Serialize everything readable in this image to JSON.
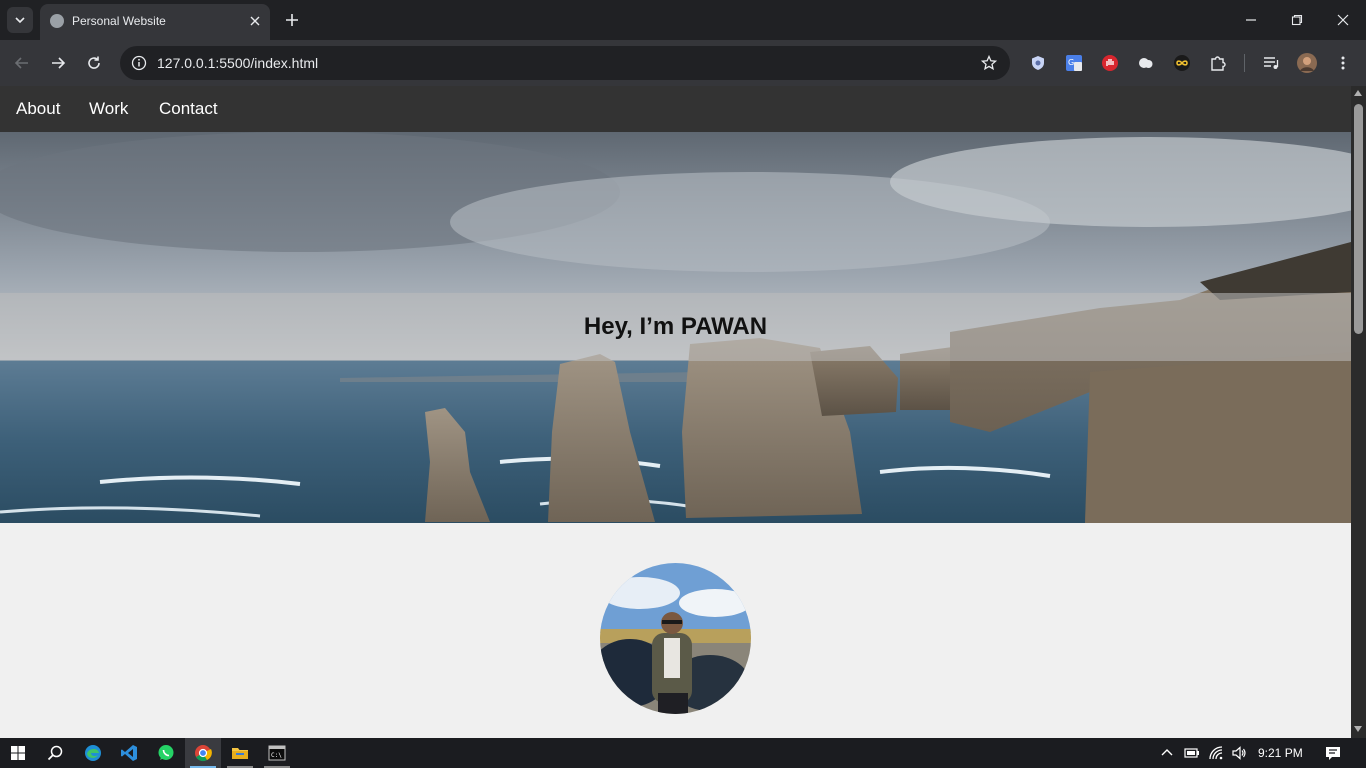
{
  "browser": {
    "tab_title": "Personal Website",
    "url": "127.0.0.1:5500/index.html"
  },
  "site": {
    "nav": [
      "About",
      "Work",
      "Contact"
    ],
    "hero_title": "Hey, I’m PAWAN"
  },
  "taskbar": {
    "apps": [
      "windows-start",
      "search",
      "edge",
      "vscode",
      "whatsapp",
      "chrome",
      "file-explorer",
      "terminal"
    ],
    "time": "9:21 PM"
  }
}
